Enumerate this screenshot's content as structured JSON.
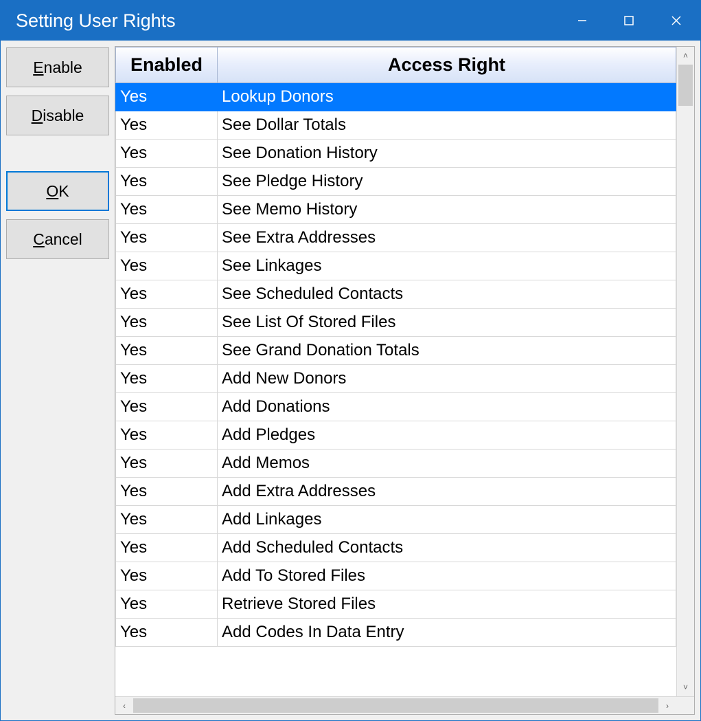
{
  "window": {
    "title": "Setting User Rights"
  },
  "buttons": {
    "enable": "Enable",
    "disable": "Disable",
    "ok": "OK",
    "cancel": "Cancel"
  },
  "grid": {
    "columns": {
      "enabled": "Enabled",
      "access_right": "Access Right"
    },
    "selected_index": 0,
    "rows": [
      {
        "enabled": "Yes",
        "right": "Lookup Donors"
      },
      {
        "enabled": "Yes",
        "right": "See Dollar Totals"
      },
      {
        "enabled": "Yes",
        "right": "See Donation History"
      },
      {
        "enabled": "Yes",
        "right": "See Pledge History"
      },
      {
        "enabled": "Yes",
        "right": "See Memo History"
      },
      {
        "enabled": "Yes",
        "right": "See Extra Addresses"
      },
      {
        "enabled": "Yes",
        "right": "See Linkages"
      },
      {
        "enabled": "Yes",
        "right": "See Scheduled Contacts"
      },
      {
        "enabled": "Yes",
        "right": "See List Of Stored Files"
      },
      {
        "enabled": "Yes",
        "right": "See Grand Donation Totals"
      },
      {
        "enabled": "Yes",
        "right": "Add New Donors"
      },
      {
        "enabled": "Yes",
        "right": "Add Donations"
      },
      {
        "enabled": "Yes",
        "right": "Add Pledges"
      },
      {
        "enabled": "Yes",
        "right": "Add Memos"
      },
      {
        "enabled": "Yes",
        "right": "Add Extra Addresses"
      },
      {
        "enabled": "Yes",
        "right": "Add Linkages"
      },
      {
        "enabled": "Yes",
        "right": "Add Scheduled Contacts"
      },
      {
        "enabled": "Yes",
        "right": "Add To Stored Files"
      },
      {
        "enabled": "Yes",
        "right": "Retrieve Stored Files"
      },
      {
        "enabled": "Yes",
        "right": "Add Codes In Data Entry"
      }
    ]
  }
}
